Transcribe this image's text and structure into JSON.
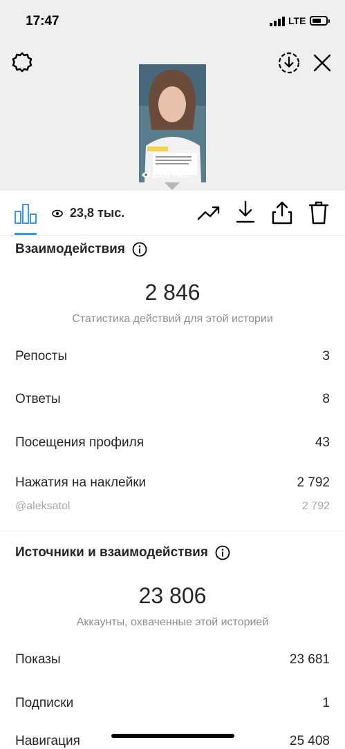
{
  "status_bar": {
    "time": "17:47",
    "network": "LTE"
  },
  "story_preview": {
    "views_overlay": "23,8 тыс."
  },
  "toolbar": {
    "views": "23,8 тыс."
  },
  "interactions": {
    "title": "Взаимодействия",
    "total": "2 846",
    "caption": "Статистика действий для этой истории",
    "rows": [
      {
        "label": "Репосты",
        "value": "3"
      },
      {
        "label": "Ответы",
        "value": "8"
      },
      {
        "label": "Посещения профиля",
        "value": "43"
      },
      {
        "label": "Нажатия на наклейки",
        "value": "2 792"
      }
    ],
    "sticker": {
      "label": "@aleksatol",
      "value": "2 792"
    }
  },
  "discovery": {
    "title": "Источники и взаимодействия",
    "total": "23 806",
    "caption": "Аккаунты, охваченные этой историей",
    "rows": [
      {
        "label": "Показы",
        "value": "23 681"
      },
      {
        "label": "Подписки",
        "value": "1"
      },
      {
        "label": "Навигация",
        "value": "25 408"
      }
    ]
  }
}
